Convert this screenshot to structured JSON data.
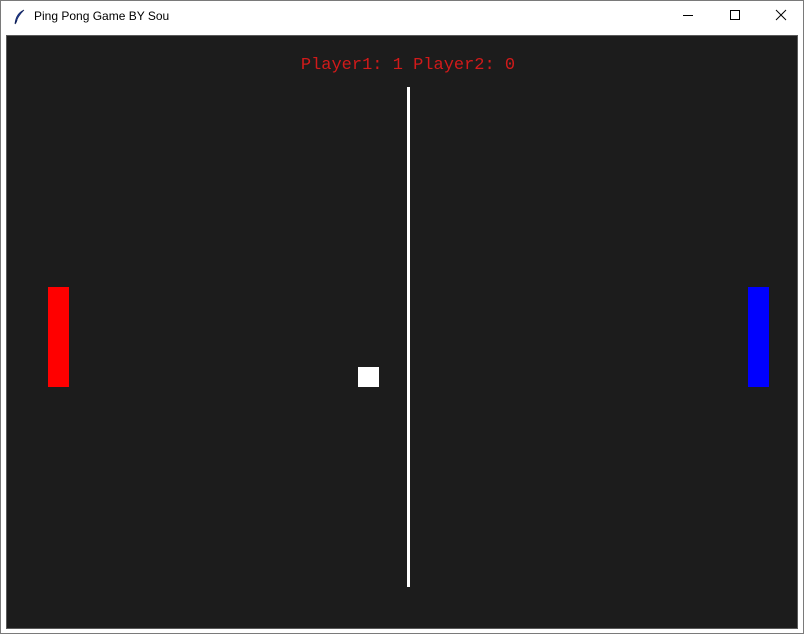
{
  "window": {
    "title": "Ping Pong Game BY Sou",
    "app_icon": "feather-icon",
    "controls": {
      "minimize_icon": "minimize-icon",
      "maximize_icon": "maximize-icon",
      "close_icon": "close-icon"
    }
  },
  "game": {
    "score_text": "Player1: 1 Player2: 0",
    "score": {
      "player1": 1,
      "player2": 0
    },
    "colors": {
      "background": "#1c1c1c",
      "score": "#d11a1a",
      "left_paddle": "#ff0000",
      "right_paddle": "#0000ff",
      "ball": "#ffffff",
      "net": "#ffffff"
    }
  }
}
